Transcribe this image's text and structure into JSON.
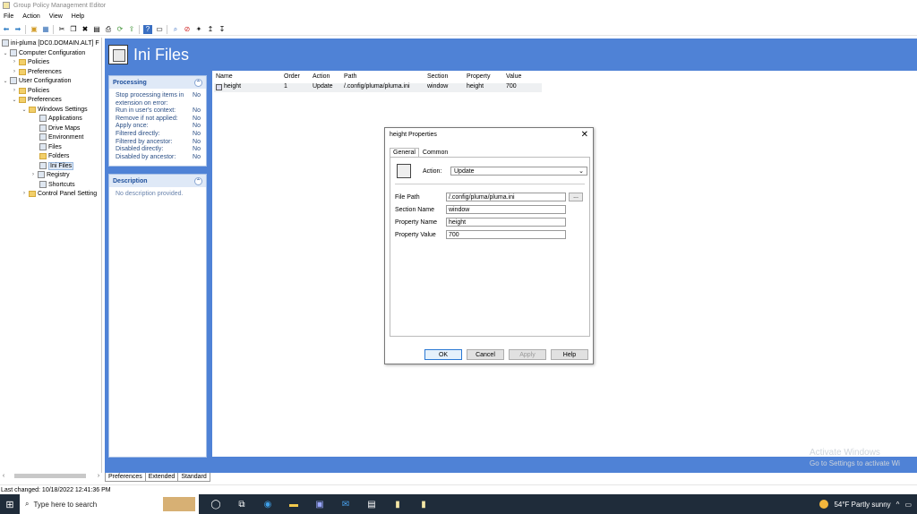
{
  "window": {
    "title": "Group Policy Management Editor"
  },
  "menu": [
    "File",
    "Action",
    "View",
    "Help"
  ],
  "tree": {
    "root": "ini-pluma [DC0.DOMAIN.ALT] F",
    "items": [
      {
        "label": "Computer Configuration",
        "level": 0,
        "expanded": true
      },
      {
        "label": "Policies",
        "level": 1
      },
      {
        "label": "Preferences",
        "level": 1
      },
      {
        "label": "User Configuration",
        "level": 0,
        "expanded": true
      },
      {
        "label": "Policies",
        "level": 1
      },
      {
        "label": "Preferences",
        "level": 1,
        "expanded": true
      },
      {
        "label": "Windows Settings",
        "level": 2,
        "expanded": true
      },
      {
        "label": "Applications",
        "level": 3
      },
      {
        "label": "Drive Maps",
        "level": 3
      },
      {
        "label": "Environment",
        "level": 3
      },
      {
        "label": "Files",
        "level": 3
      },
      {
        "label": "Folders",
        "level": 3
      },
      {
        "label": "Ini Files",
        "level": 3,
        "selected": true
      },
      {
        "label": "Registry",
        "level": 3
      },
      {
        "label": "Shortcuts",
        "level": 3
      },
      {
        "label": "Control Panel Setting",
        "level": 2
      }
    ]
  },
  "banner": {
    "title": "Ini Files"
  },
  "processing": {
    "title": "Processing",
    "rows": [
      {
        "k": "Stop processing items in extension on error:",
        "v": "No"
      },
      {
        "k": "Run in user's context:",
        "v": "No"
      },
      {
        "k": "Remove if not applied:",
        "v": "No"
      },
      {
        "k": "Apply once:",
        "v": "No"
      },
      {
        "k": "Filtered directly:",
        "v": "No"
      },
      {
        "k": "Filtered by ancestor:",
        "v": "No"
      },
      {
        "k": "Disabled directly:",
        "v": "No"
      },
      {
        "k": "Disabled by ancestor:",
        "v": "No"
      }
    ]
  },
  "description": {
    "title": "Description",
    "text": "No description provided."
  },
  "list": {
    "columns": [
      "Name",
      "Order",
      "Action",
      "Path",
      "Section",
      "Property",
      "Value"
    ],
    "rows": [
      {
        "name": "height",
        "order": "1",
        "action": "Update",
        "path": "/.config/pluma/pluma.ini",
        "section": "window",
        "property": "height",
        "value": "700"
      }
    ]
  },
  "bottom_tabs": [
    "Preferences",
    "Extended",
    "Standard"
  ],
  "status": "Last changed: 10/18/2022 12:41:36 PM",
  "watermark": {
    "line1": "Activate Windows",
    "line2": "Go to Settings to activate Wi"
  },
  "dialog": {
    "title": "height Properties",
    "tabs": [
      "General",
      "Common"
    ],
    "action_label": "Action:",
    "action_value": "Update",
    "fields": [
      {
        "label": "File Path",
        "value": "/.config/pluma/pluma.ini"
      },
      {
        "label": "Section Name",
        "value": "window"
      },
      {
        "label": "Property Name",
        "value": "height"
      },
      {
        "label": "Property Value",
        "value": "700"
      }
    ],
    "browse": "...",
    "buttons": [
      "OK",
      "Cancel",
      "Apply",
      "Help"
    ]
  },
  "taskbar": {
    "search_placeholder": "Type here to search",
    "weather": "54°F  Partly sunny"
  }
}
